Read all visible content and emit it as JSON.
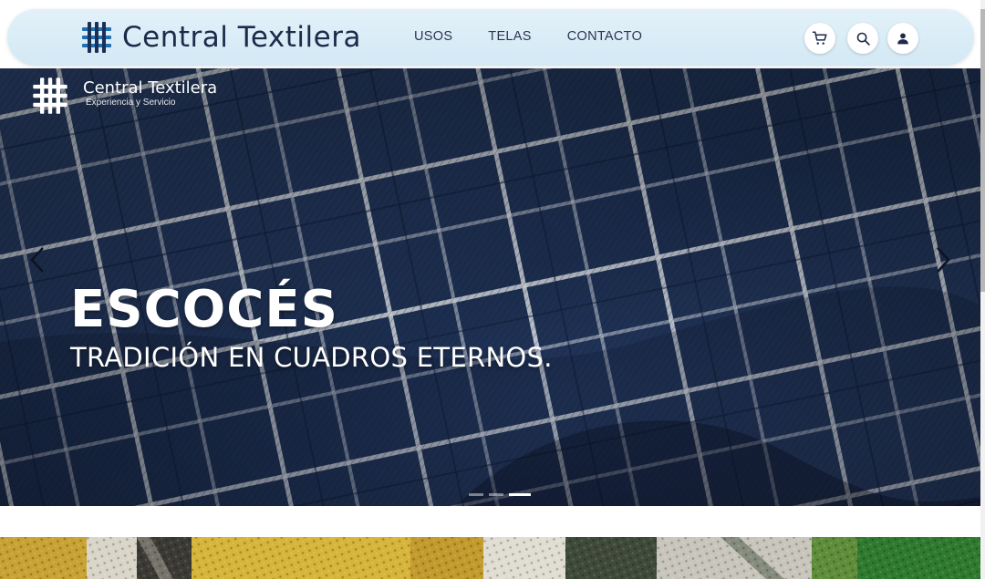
{
  "header": {
    "brand": "Central Textilera",
    "nav": [
      {
        "label": "USOS"
      },
      {
        "label": "TELAS"
      },
      {
        "label": "CONTACTO"
      }
    ],
    "icons": {
      "cart": "cart-icon",
      "search": "search-icon",
      "user": "user-icon"
    }
  },
  "hero": {
    "logo_name": "Central Textilera",
    "logo_tagline": "Experiencia y Servicio",
    "title": "ESCOCÉS",
    "subtitle": "TRADICIÓN EN CUADROS ETERNOS.",
    "slides_count": 3,
    "active_slide": 3,
    "prev_icon": "chevron-left-icon",
    "next_icon": "chevron-right-icon"
  },
  "colors": {
    "header_bg": "#d8ecf6",
    "brand_blue": "#1f6fb3",
    "fabric_navy": "#23375a",
    "text_dark": "#1d2a4a"
  }
}
